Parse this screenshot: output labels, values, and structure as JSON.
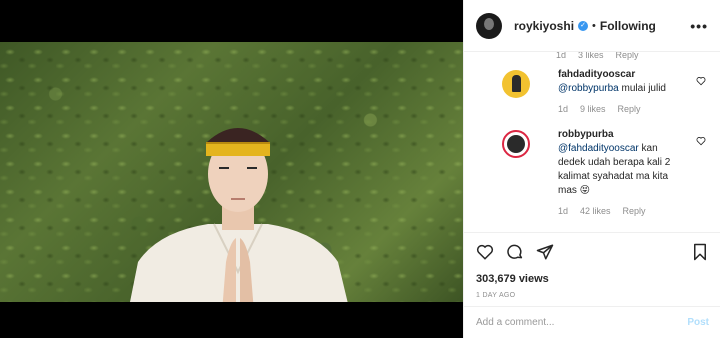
{
  "header": {
    "username": "roykiyoshi",
    "separator": "•",
    "follow_label": "Following",
    "more_label": "•••"
  },
  "partial_comment": {
    "time": "1d",
    "likes": "3 likes",
    "reply": "Reply"
  },
  "comments": [
    {
      "username": "fahdadityooscar",
      "mention": "@robbypurba",
      "text": " mulai julid",
      "time": "1d",
      "likes": "9 likes",
      "reply": "Reply"
    },
    {
      "username": "robbypurba",
      "mention": "@fahdadityooscar",
      "text": " kan dedek udah berapa kali 2 kalimat syahadat ma kita mas 😝",
      "time": "1d",
      "likes": "42 likes",
      "reply": "Reply"
    }
  ],
  "post": {
    "views": "303,679 views",
    "ago": "1 DAY AGO"
  },
  "add_comment": {
    "placeholder": "Add a comment...",
    "post_label": "Post"
  },
  "colors": {
    "verified": "#3897f0",
    "mention": "#003569",
    "muted": "#8e8e8e",
    "post_disabled": "#b2dffc"
  }
}
